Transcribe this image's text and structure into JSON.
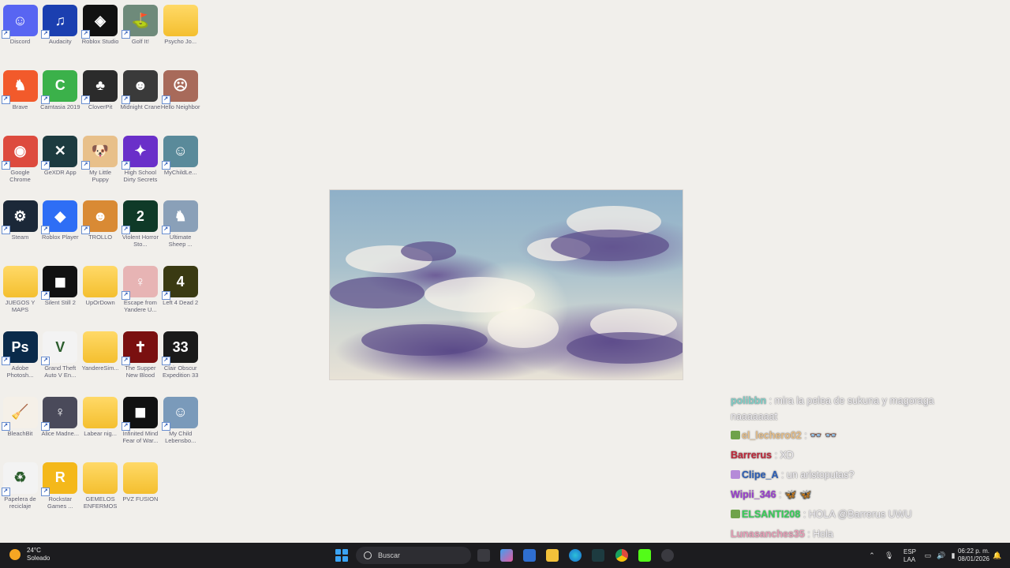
{
  "desktop": {
    "icons": [
      {
        "label": "Discord",
        "kind": "app",
        "color": "#5865f2",
        "glyph": "☺"
      },
      {
        "label": "Audacity",
        "kind": "app",
        "color": "#1b3fb0",
        "glyph": "♫"
      },
      {
        "label": "Roblox Studio",
        "kind": "app",
        "color": "#111111",
        "glyph": "◈"
      },
      {
        "label": "Golf It!",
        "kind": "app",
        "color": "#6e8a7a",
        "glyph": "⛳"
      },
      {
        "label": "Psycho Jo...",
        "kind": "folder"
      },
      {
        "label": "Brave",
        "kind": "app",
        "color": "#f25a2b",
        "glyph": "♞"
      },
      {
        "label": "Camtasia 2019",
        "kind": "app",
        "color": "#3bb14a",
        "glyph": "C"
      },
      {
        "label": "CloverPit",
        "kind": "app",
        "color": "#2b2b2b",
        "glyph": "♣"
      },
      {
        "label": "Midnight Crane",
        "kind": "app",
        "color": "#3a3a3a",
        "glyph": "☻"
      },
      {
        "label": "Hello Neighbor",
        "kind": "app",
        "color": "#a86a5a",
        "glyph": "☹"
      },
      {
        "label": "Google Chrome",
        "kind": "app",
        "color": "#dd4b3e",
        "glyph": "◉"
      },
      {
        "label": "GeXDR App",
        "kind": "app",
        "color": "#1d3b40",
        "glyph": "✕"
      },
      {
        "label": "My Little Puppy",
        "kind": "app",
        "color": "#e8c08a",
        "glyph": "🐶"
      },
      {
        "label": "High School Dirty Secrets",
        "kind": "app",
        "color": "#6a2fc9",
        "glyph": "✦"
      },
      {
        "label": "MyChildLe...",
        "kind": "app",
        "color": "#5a8a9a",
        "glyph": "☺"
      },
      {
        "label": "Steam",
        "kind": "app",
        "color": "#1b2838",
        "glyph": "⚙"
      },
      {
        "label": "Roblox Player",
        "kind": "app",
        "color": "#2e6ef5",
        "glyph": "◆"
      },
      {
        "label": "TROLLO",
        "kind": "app",
        "color": "#d98a34",
        "glyph": "☻"
      },
      {
        "label": "Violent Horror Sto...",
        "kind": "app",
        "color": "#0f3a28",
        "glyph": "2"
      },
      {
        "label": "Ultimate Sheep ...",
        "kind": "app",
        "color": "#8aa0b8",
        "glyph": "♞"
      },
      {
        "label": "JUEGOS Y MAPS",
        "kind": "folder"
      },
      {
        "label": "Silent Still 2",
        "kind": "app",
        "color": "#111111",
        "glyph": "◼"
      },
      {
        "label": "UpOrDown",
        "kind": "folder"
      },
      {
        "label": "Escape from Yandere U...",
        "kind": "app",
        "color": "#e7b4b4",
        "glyph": "♀"
      },
      {
        "label": "Left 4 Dead 2",
        "kind": "app",
        "color": "#3a3a12",
        "glyph": "4"
      },
      {
        "label": "Adobe Photosh...",
        "kind": "app",
        "color": "#0a2a4a",
        "glyph": "Ps"
      },
      {
        "label": "Grand Theft Auto V En...",
        "kind": "app",
        "color": "#f3f3f3",
        "glyph": "V"
      },
      {
        "label": "YandereSim...",
        "kind": "folder"
      },
      {
        "label": "The Supper New Blood",
        "kind": "app",
        "color": "#7a1010",
        "glyph": "✝"
      },
      {
        "label": "Clair Obscur Expedition 33",
        "kind": "app",
        "color": "#1a1a1a",
        "glyph": "33"
      },
      {
        "label": "BleachBit",
        "kind": "app",
        "color": "#f5f0e8",
        "glyph": "🧹"
      },
      {
        "label": "Alice Madne...",
        "kind": "app",
        "color": "#4a4a5a",
        "glyph": "♀"
      },
      {
        "label": "Labear nig...",
        "kind": "folder"
      },
      {
        "label": "Infinited Mind Fear of War...",
        "kind": "app",
        "color": "#111111",
        "glyph": "◼"
      },
      {
        "label": "My Child Lebensbo...",
        "kind": "app",
        "color": "#7a9aba",
        "glyph": "☺"
      },
      {
        "label": "Papelera de reciclaje",
        "kind": "app",
        "color": "#f3f3f3",
        "glyph": "♻"
      },
      {
        "label": "Rockstar Games ...",
        "kind": "app",
        "color": "#f4b81a",
        "glyph": "R"
      },
      {
        "label": "GEMELOS ENFERMOS",
        "kind": "folder"
      },
      {
        "label": "PVZ FUSION",
        "kind": "folder"
      }
    ]
  },
  "chat": [
    {
      "user": "polibbn",
      "user_color": "#7fd0c8",
      "text": ": mira la pelea de sukuna y magoraga naaaaaaat",
      "badge": null
    },
    {
      "user": "el_lechero02",
      "user_color": "#e8c08a",
      "text": ": 👓 👓",
      "badge": "#6fa24a"
    },
    {
      "user": "Barrerus",
      "user_color": "#c0283a",
      "text": ": XD",
      "badge": null
    },
    {
      "user": "Clipe_A",
      "user_color": "#2c5fb8",
      "text": ": un aristoputas?",
      "badge": "#b58ad8"
    },
    {
      "user": "Wipii_346",
      "user_color": "#9b3fd0",
      "text": ": 🦋 🦋",
      "badge": null
    },
    {
      "user": "ELSANTI208",
      "user_color": "#39d05a",
      "text": ": HOLA @Barrerus UWU",
      "badge": "#6fa24a"
    },
    {
      "user": "Lunasanches35",
      "user_color": "#e8a0b8",
      "text": ": Hola",
      "badge": null
    }
  ],
  "taskbar": {
    "weather_temp": "24°C",
    "weather_desc": "Soleado",
    "search_placeholder": "Buscar",
    "lang_top": "ESP",
    "lang_bottom": "LAA",
    "time": "06:22 p. m.",
    "date": "08/01/2026"
  }
}
